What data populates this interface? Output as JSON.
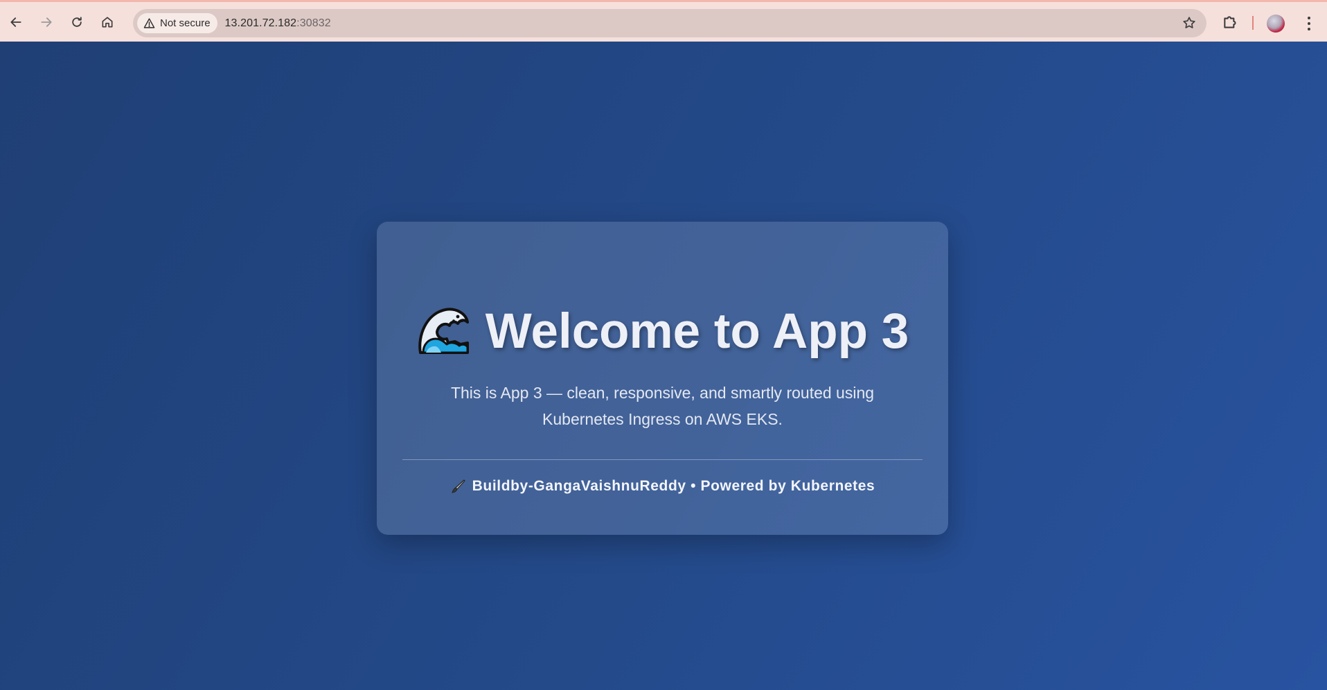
{
  "browser": {
    "security_label": "Not secure",
    "url_host": "13.201.72.182",
    "url_port": ":30832"
  },
  "card": {
    "title": "Welcome to App 3",
    "title_icon": "water-wave-icon",
    "description_line1": "This is App 3 — clean, responsive, and smartly routed using",
    "description_line2": "Kubernetes Ingress on AWS EKS.",
    "footer_icon": "paintbrush-icon",
    "footer_text": "Buildby-GangaVaishnuReddy • Powered by Kubernetes"
  },
  "colors": {
    "background": "#244a8a",
    "card": "rgba(255,255,255,0.14)",
    "chrome": "#f6e0dc"
  }
}
